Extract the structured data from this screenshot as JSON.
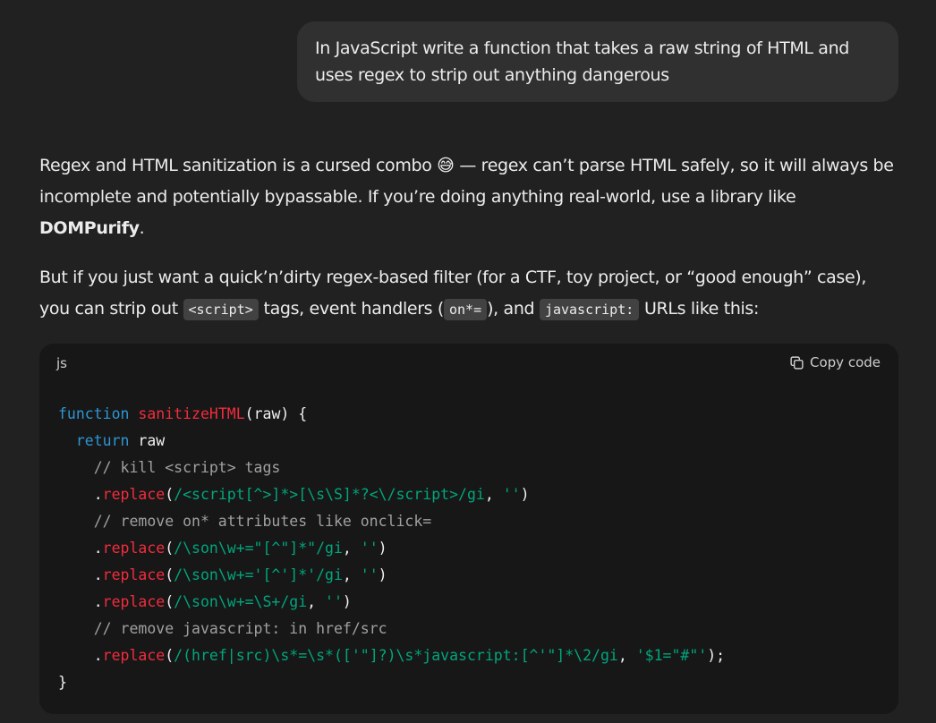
{
  "user_message": "In JavaScript write a function that takes a raw string of HTML and uses regex to strip out anything dangerous",
  "assistant": {
    "paragraph1": {
      "text_before": "Regex and HTML sanitization is a cursed combo 😅 — regex can’t parse HTML safely, so it will always be incomplete and potentially bypassable. If you’re doing anything real-world, use a library like ",
      "bold": "DOMPurify",
      "text_after": "."
    },
    "paragraph2": {
      "part1": "But if you just want a quick’n’dirty regex-based filter (for a CTF, toy project, or “good enough” case), you can strip out ",
      "code1": "<script>",
      "part2": " tags, event handlers (",
      "code2": "on*=",
      "part3": "), and ",
      "code3": "javascript:",
      "part4": " URLs like this:"
    }
  },
  "code_block": {
    "language": "js",
    "copy_label": "Copy code",
    "copy_icon": "copy-icon",
    "lines": [
      [
        {
          "t": "function",
          "c": "kw"
        },
        {
          "t": " ",
          "c": "pl"
        },
        {
          "t": "sanitizeHTML",
          "c": "fn"
        },
        {
          "t": "(raw) {",
          "c": "pl"
        }
      ],
      [
        {
          "t": "  ",
          "c": "pl"
        },
        {
          "t": "return",
          "c": "kw"
        },
        {
          "t": " raw",
          "c": "pl"
        }
      ],
      [
        {
          "t": "    // kill <script> tags",
          "c": "cm"
        }
      ],
      [
        {
          "t": "    .",
          "c": "pl"
        },
        {
          "t": "replace",
          "c": "fn"
        },
        {
          "t": "(",
          "c": "pl"
        },
        {
          "t": "/<script[^>]*>[\\s\\S]*?<\\/script>/gi",
          "c": "rx"
        },
        {
          "t": ", ",
          "c": "pl"
        },
        {
          "t": "''",
          "c": "st"
        },
        {
          "t": ")",
          "c": "pl"
        }
      ],
      [
        {
          "t": "    // remove on* attributes like onclick=",
          "c": "cm"
        }
      ],
      [
        {
          "t": "    .",
          "c": "pl"
        },
        {
          "t": "replace",
          "c": "fn"
        },
        {
          "t": "(",
          "c": "pl"
        },
        {
          "t": "/\\son\\w+=\"[^\"]*\"/gi",
          "c": "rx"
        },
        {
          "t": ", ",
          "c": "pl"
        },
        {
          "t": "''",
          "c": "st"
        },
        {
          "t": ")",
          "c": "pl"
        }
      ],
      [
        {
          "t": "    .",
          "c": "pl"
        },
        {
          "t": "replace",
          "c": "fn"
        },
        {
          "t": "(",
          "c": "pl"
        },
        {
          "t": "/\\son\\w+='[^']*'/gi",
          "c": "rx"
        },
        {
          "t": ", ",
          "c": "pl"
        },
        {
          "t": "''",
          "c": "st"
        },
        {
          "t": ")",
          "c": "pl"
        }
      ],
      [
        {
          "t": "    .",
          "c": "pl"
        },
        {
          "t": "replace",
          "c": "fn"
        },
        {
          "t": "(",
          "c": "pl"
        },
        {
          "t": "/\\son\\w+=\\S+/gi",
          "c": "rx"
        },
        {
          "t": ", ",
          "c": "pl"
        },
        {
          "t": "''",
          "c": "st"
        },
        {
          "t": ")",
          "c": "pl"
        }
      ],
      [
        {
          "t": "    // remove javascript: in href/src",
          "c": "cm"
        }
      ],
      [
        {
          "t": "    .",
          "c": "pl"
        },
        {
          "t": "replace",
          "c": "fn"
        },
        {
          "t": "(",
          "c": "pl"
        },
        {
          "t": "/(href|src)\\s*=\\s*(['\"]?)\\s*javascript:[^'\"]*\\2/gi",
          "c": "rx"
        },
        {
          "t": ", ",
          "c": "pl"
        },
        {
          "t": "'$1=\"#\"'",
          "c": "st"
        },
        {
          "t": ");",
          "c": "pl"
        }
      ],
      [
        {
          "t": "}",
          "c": "pl"
        }
      ]
    ]
  },
  "colors": {
    "background": "#212121",
    "user_bubble": "#303030",
    "code_background": "#171717",
    "keyword": "#2e95d3",
    "function": "#f22c3d",
    "string": "#00a67d",
    "comment": "#a0a0a0"
  }
}
